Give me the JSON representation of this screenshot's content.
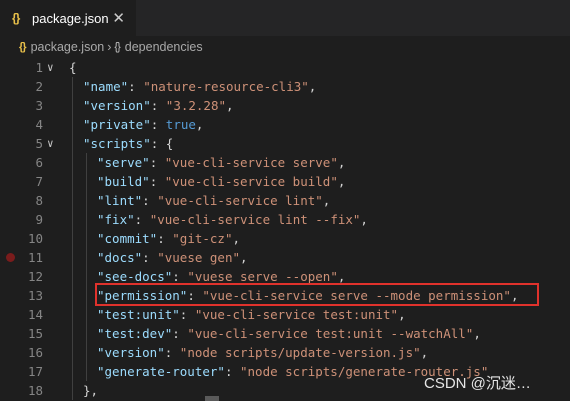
{
  "tab": {
    "icon": "{}",
    "label": "package.json",
    "close": "✕"
  },
  "breadcrumb": {
    "file_icon": "{}",
    "file": "package.json",
    "sep": "›",
    "obj_icon": "{}",
    "node": "dependencies"
  },
  "lines": [
    {
      "n": "1",
      "fold": "∨",
      "tokens": [
        [
          "p",
          "{"
        ]
      ]
    },
    {
      "n": "2",
      "tokens": [
        [
          "k",
          "\"name\""
        ],
        [
          "p",
          ": "
        ],
        [
          "s",
          "\"nature-resource-cli3\""
        ],
        [
          "p",
          ","
        ]
      ]
    },
    {
      "n": "3",
      "tokens": [
        [
          "k",
          "\"version\""
        ],
        [
          "p",
          ": "
        ],
        [
          "s",
          "\"3.2.28\""
        ],
        [
          "p",
          ","
        ]
      ]
    },
    {
      "n": "4",
      "tokens": [
        [
          "k",
          "\"private\""
        ],
        [
          "p",
          ": "
        ],
        [
          "b",
          "true"
        ],
        [
          "p",
          ","
        ]
      ]
    },
    {
      "n": "5",
      "fold": "∨",
      "tokens": [
        [
          "k",
          "\"scripts\""
        ],
        [
          "p",
          ": {"
        ]
      ]
    },
    {
      "n": "6",
      "tokens": [
        [
          "k",
          "\"serve\""
        ],
        [
          "p",
          ": "
        ],
        [
          "s",
          "\"vue-cli-service serve\""
        ],
        [
          "p",
          ","
        ]
      ]
    },
    {
      "n": "7",
      "tokens": [
        [
          "k",
          "\"build\""
        ],
        [
          "p",
          ": "
        ],
        [
          "s",
          "\"vue-cli-service build\""
        ],
        [
          "p",
          ","
        ]
      ]
    },
    {
      "n": "8",
      "tokens": [
        [
          "k",
          "\"lint\""
        ],
        [
          "p",
          ": "
        ],
        [
          "s",
          "\"vue-cli-service lint\""
        ],
        [
          "p",
          ","
        ]
      ]
    },
    {
      "n": "9",
      "tokens": [
        [
          "k",
          "\"fix\""
        ],
        [
          "p",
          ": "
        ],
        [
          "s",
          "\"vue-cli-service lint --fix\""
        ],
        [
          "p",
          ","
        ]
      ]
    },
    {
      "n": "10",
      "tokens": [
        [
          "k",
          "\"commit\""
        ],
        [
          "p",
          ": "
        ],
        [
          "s",
          "\"git-cz\""
        ],
        [
          "p",
          ","
        ]
      ]
    },
    {
      "n": "11",
      "breakpoint": true,
      "tokens": [
        [
          "k",
          "\"docs\""
        ],
        [
          "p",
          ": "
        ],
        [
          "s",
          "\"vuese gen\""
        ],
        [
          "p",
          ","
        ]
      ]
    },
    {
      "n": "12",
      "tokens": [
        [
          "k",
          "\"see-docs\""
        ],
        [
          "p",
          ": "
        ],
        [
          "s",
          "\"vuese serve --open\""
        ],
        [
          "p",
          ","
        ]
      ]
    },
    {
      "n": "13",
      "tokens": [
        [
          "k",
          "\"permission\""
        ],
        [
          "p",
          ": "
        ],
        [
          "s",
          "\"vue-cli-service serve --mode permission\""
        ],
        [
          "p",
          ","
        ]
      ]
    },
    {
      "n": "14",
      "tokens": [
        [
          "k",
          "\"test:unit\""
        ],
        [
          "p",
          ": "
        ],
        [
          "s",
          "\"vue-cli-service test:unit\""
        ],
        [
          "p",
          ","
        ]
      ]
    },
    {
      "n": "15",
      "tokens": [
        [
          "k",
          "\"test:dev\""
        ],
        [
          "p",
          ": "
        ],
        [
          "s",
          "\"vue-cli-service test:unit --watchAll\""
        ],
        [
          "p",
          ","
        ]
      ]
    },
    {
      "n": "16",
      "tokens": [
        [
          "k",
          "\"version\""
        ],
        [
          "p",
          ": "
        ],
        [
          "s",
          "\"node scripts/update-version.js\""
        ],
        [
          "p",
          ","
        ]
      ]
    },
    {
      "n": "17",
      "tokens": [
        [
          "k",
          "\"generate-router\""
        ],
        [
          "p",
          ": "
        ],
        [
          "s",
          "\"node scripts/generate-router.js\""
        ]
      ]
    },
    {
      "n": "18",
      "tokens": [
        [
          "p",
          "},"
        ]
      ]
    }
  ],
  "watermark": "CSDN @沉迷…",
  "colors": {
    "background": "#1e1e1e",
    "key": "#9cdcfe",
    "string": "#ce9178",
    "keyword": "#569cd6",
    "highlight_box": "#e0322c"
  }
}
